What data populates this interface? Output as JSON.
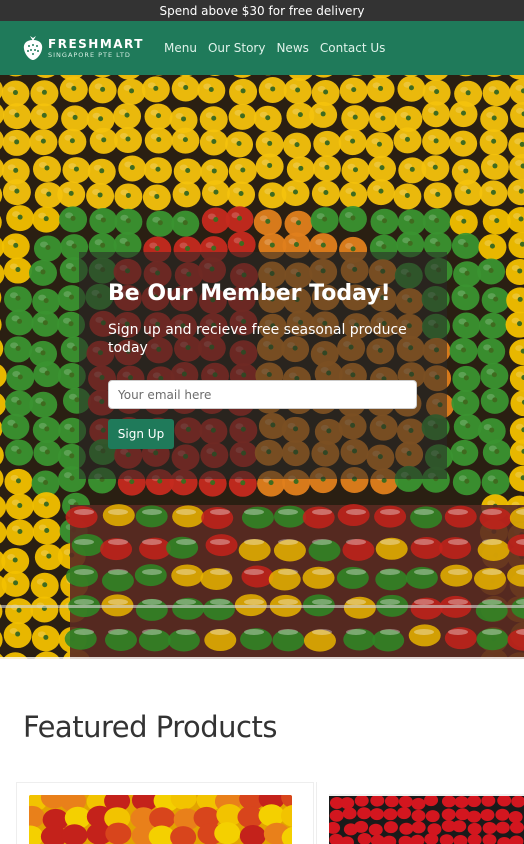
{
  "promo_bar": {
    "text": "Spend above $30 for free delivery"
  },
  "brand": {
    "name": "FRESHMART",
    "tagline": "SINGAPORE PTE LTD"
  },
  "nav": {
    "items": [
      {
        "label": "Menu"
      },
      {
        "label": "Our Story"
      },
      {
        "label": "News"
      },
      {
        "label": "Contact Us"
      }
    ]
  },
  "hero": {
    "title": "Be Our Member Today!",
    "subtitle": "Sign up and recieve free seasonal produce today",
    "email_placeholder": "Your email here",
    "button_label": "Sign Up"
  },
  "featured": {
    "title": "Featured Products",
    "products": [
      {
        "image": "peppers-photo"
      },
      {
        "image": "strawberries-photo"
      }
    ]
  },
  "colors": {
    "promo_bg": "#333333",
    "brand_green": "#1f7a5a",
    "overlay": "rgba(40,40,40,0.55)"
  }
}
